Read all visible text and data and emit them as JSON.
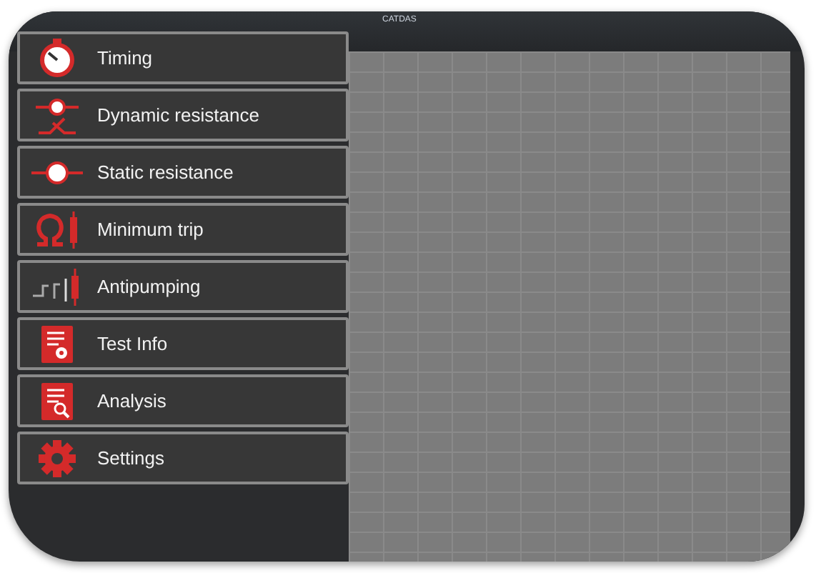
{
  "window": {
    "title": "CATDAS"
  },
  "menu": [
    {
      "label": "Timing"
    },
    {
      "label": "Dynamic resistance"
    },
    {
      "label": "Static resistance"
    },
    {
      "label": "Minimum trip"
    },
    {
      "label": "Antipumping"
    },
    {
      "label": "Test Info"
    },
    {
      "label": "Analysis"
    },
    {
      "label": "Settings"
    }
  ]
}
